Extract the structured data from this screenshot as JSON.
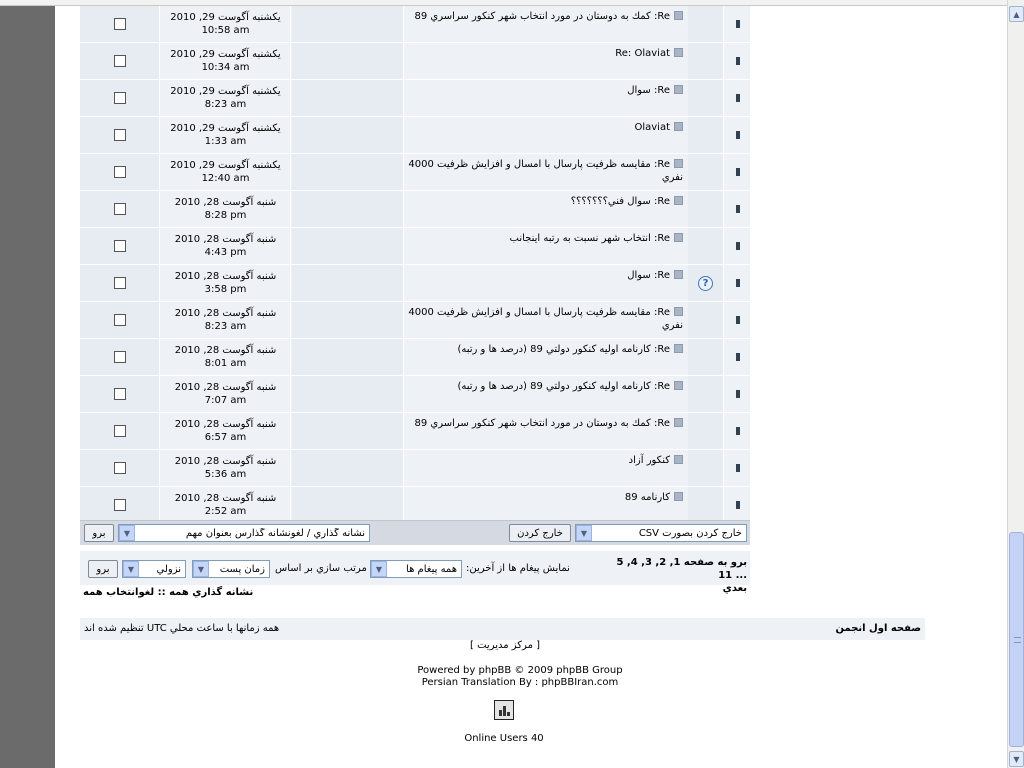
{
  "posts": [
    {
      "subject": "Re: كمك به دوستان در مورد انتخاب شهر كنكور سراسري 89",
      "day": "يكشنبه آگوست 29, 2010",
      "time": "10:58 am",
      "icon": "square"
    },
    {
      "subject": "Re: Olaviat",
      "day": "يكشنبه آگوست 29, 2010",
      "time": "10:34 am",
      "icon": "square"
    },
    {
      "subject": "Re: سوال",
      "day": "يكشنبه آگوست 29, 2010",
      "time": "8:23 am",
      "icon": "square"
    },
    {
      "subject": "Olaviat",
      "day": "يكشنبه آگوست 29, 2010",
      "time": "1:33 am",
      "icon": "square"
    },
    {
      "subject": "Re: مقايسه ظرفيت پارسال با امسال و افزايش ظرفيت 4000 نفري",
      "day": "يكشنبه آگوست 29, 2010",
      "time": "12:40 am",
      "icon": "square"
    },
    {
      "subject": "Re: سوال فني؟؟؟؟؟؟؟",
      "day": "شنبه آگوست 28, 2010",
      "time": "8:28 pm",
      "icon": "square"
    },
    {
      "subject": "Re: انتخاب شهر نسبت به رتبه اينجانب",
      "day": "شنبه آگوست 28, 2010",
      "time": "4:43 pm",
      "icon": "square"
    },
    {
      "subject": "Re: سوال",
      "day": "شنبه آگوست 28, 2010",
      "time": "3:58 pm",
      "icon": "question"
    },
    {
      "subject": "Re: مقايسه ظرفيت پارسال با امسال و افزايش ظرفيت 4000 نفري",
      "day": "شنبه آگوست 28, 2010",
      "time": "8:23 am",
      "icon": "square"
    },
    {
      "subject": "Re: كارنامه اوليه كنكور دولتي 89 (درصد ها و رتبه)",
      "day": "شنبه آگوست 28, 2010",
      "time": "8:01 am",
      "icon": "square"
    },
    {
      "subject": "Re: كارنامه اوليه كنكور دولتي 89 (درصد ها و رتبه)",
      "day": "شنبه آگوست 28, 2010",
      "time": "7:07 am",
      "icon": "square"
    },
    {
      "subject": "Re: كمك به دوستان در مورد انتخاب شهر كنكور سراسري 89",
      "day": "شنبه آگوست 28, 2010",
      "time": "6:57 am",
      "icon": "square"
    },
    {
      "subject": "كنكور آزاد",
      "day": "شنبه آگوست 28, 2010",
      "time": "5:36 am",
      "icon": "square"
    },
    {
      "subject": "كارنامه 89",
      "day": "شنبه آگوست 28, 2010",
      "time": "2:52 am",
      "icon": "square"
    }
  ],
  "actions": {
    "go_left": "برو",
    "mark_select": "نشانه گذاري / لغونشانه گذارس بعنوان مهم",
    "export_button": "خارج كردن",
    "export_select": "خارج كردن بصورت CSV"
  },
  "options": {
    "go": "برو",
    "order_select": "نزولي",
    "sortkey_select": "زمان پست",
    "sort_label": "مرتب سازي بر اساس",
    "range_select": "همه پيغام ها",
    "show_label": "نمايش پيغام ها از آخرين:",
    "pagination": "برو به صفحه 1, 2, 3, 4, 5 ... 11",
    "next": "بعدي"
  },
  "mark_all": "نشانه گذاري همه :: لغوانتخاب همه",
  "footer": {
    "home": "صفحه اول انجمن",
    "timezone": "همه زمانها با ساعت محلي UTC تنظيم شده اند",
    "admin": "[ مركز مديريت ]",
    "powered": "Powered by phpBB © 2009 phpBB Group",
    "translation": "Persian Translation By : phpBBIran.com",
    "online": "Online Users 40"
  }
}
